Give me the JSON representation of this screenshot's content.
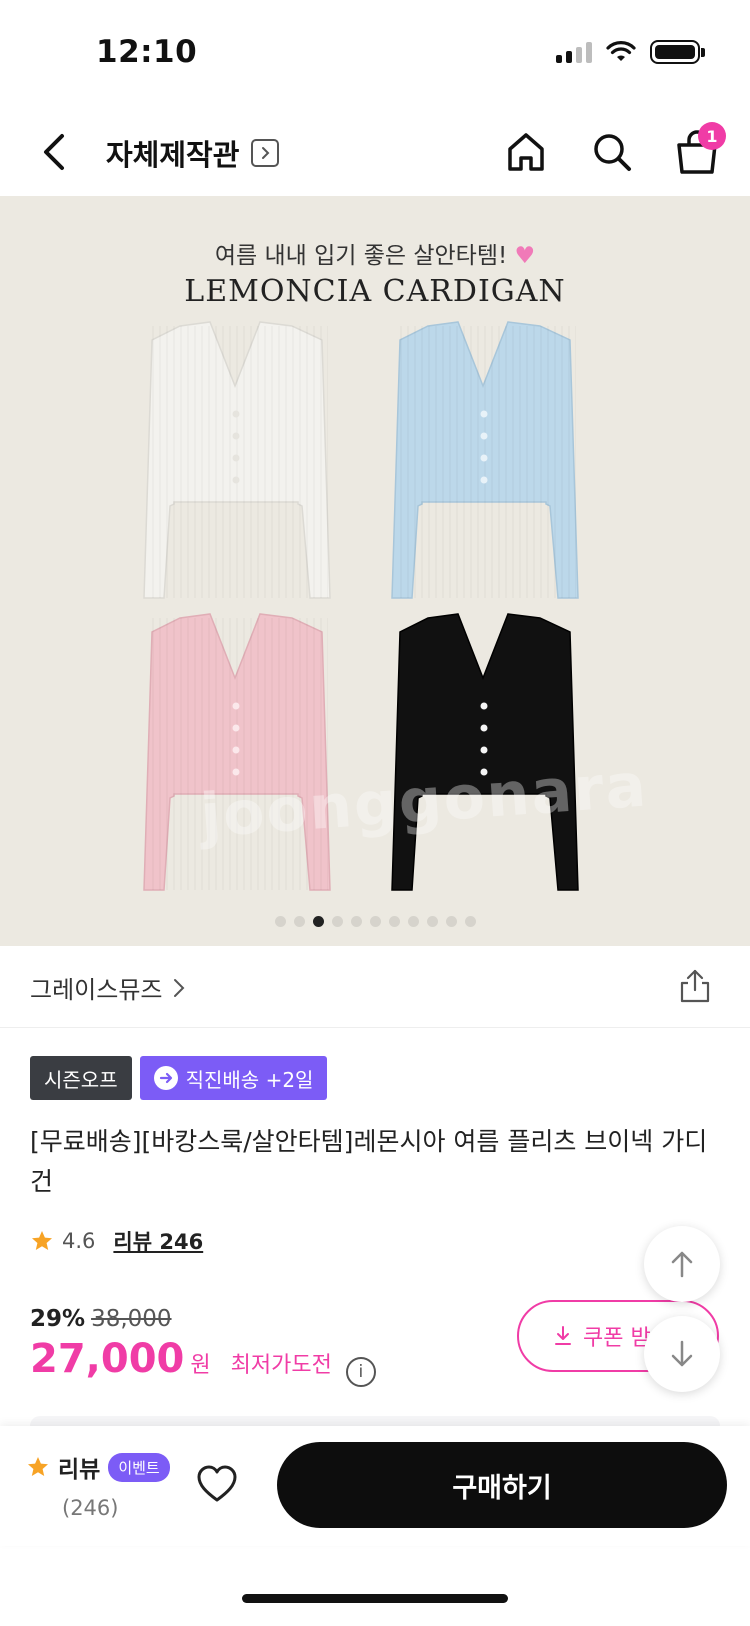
{
  "status_bar": {
    "time": "12:10"
  },
  "nav": {
    "title": "자체제작관",
    "cart_count": "1"
  },
  "hero": {
    "subtitle": "여름 내내 입기 좋은 살안타템!",
    "title": "LEMONCIA CARDIGAN",
    "watermark": "joonggonara",
    "image_count": 11,
    "active_index": 2,
    "colors": {
      "white": "#f3f2ee",
      "blue": "#bcd8ea",
      "pink": "#f0c3ca",
      "black": "#111111"
    }
  },
  "brand": {
    "name": "그레이스뮤즈"
  },
  "tags": {
    "season": "시즌오프",
    "direct": "직진배송 +2일"
  },
  "product": {
    "title": "[무료배송][바캉스룩/살안타템]레몬시아 여름 플리츠 브이넥 가디건"
  },
  "rating": {
    "score": "4.6",
    "review_label": "리뷰 246"
  },
  "price": {
    "discount": "29%",
    "original": "38,000",
    "final": "27,000",
    "unit": "원",
    "lowest_label": "최저가도전",
    "info": "i"
  },
  "coupon": {
    "label": "쿠폰 받"
  },
  "action_bar": {
    "review_label": "리뷰",
    "event_badge": "이벤트",
    "review_count": "(246)",
    "buy_label": "구매하기"
  },
  "colors": {
    "accent_pink": "#f03ca6",
    "accent_purple": "#7c5cf6",
    "dark": "#0d0d0d"
  }
}
